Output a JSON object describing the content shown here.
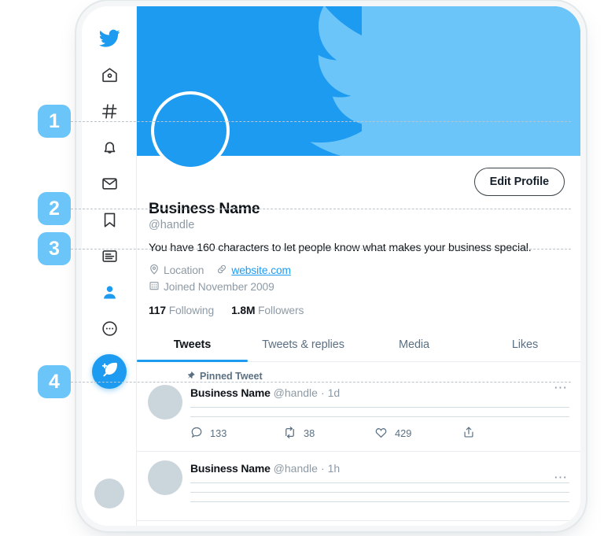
{
  "sidebar": {
    "items": [
      {
        "name": "twitter-logo",
        "icon": "twitter-bird-icon",
        "label": "Twitter"
      },
      {
        "name": "home",
        "icon": "home-icon",
        "label": "Home"
      },
      {
        "name": "explore",
        "icon": "hashtag-icon",
        "label": "Explore"
      },
      {
        "name": "notifications",
        "icon": "bell-icon",
        "label": "Notifications"
      },
      {
        "name": "messages",
        "icon": "envelope-icon",
        "label": "Messages"
      },
      {
        "name": "bookmarks",
        "icon": "bookmark-icon",
        "label": "Bookmarks"
      },
      {
        "name": "lists",
        "icon": "list-icon",
        "label": "Lists"
      },
      {
        "name": "profile",
        "icon": "person-icon",
        "label": "Profile"
      },
      {
        "name": "more",
        "icon": "more-circle-icon",
        "label": "More"
      }
    ],
    "compose": {
      "icon": "feather-plus-icon",
      "label": "Tweet"
    },
    "avatar": {
      "icon": "account-avatar",
      "label": "Account"
    }
  },
  "banner": {
    "background_color": "#1d9bf0",
    "accent_color": "#6cc5f9",
    "bird_icon": "twitter-bird-silhouette"
  },
  "profile": {
    "avatar_color": "#1d9bf0",
    "edit_button_label": "Edit Profile",
    "display_name": "Business Name",
    "handle": "@handle",
    "bio": "You have 160 characters to let people know what makes your business special.",
    "location_icon": "location-pin-icon",
    "location": "Location",
    "link_icon": "link-chain-icon",
    "website": "website.com",
    "website_color": "#1d9bf0",
    "calendar_icon": "calendar-icon",
    "joined": "Joined November 2009",
    "following_count": "117",
    "following_label": "Following",
    "followers_count": "1.8M",
    "followers_label": "Followers"
  },
  "tabs": [
    {
      "label": "Tweets",
      "active": true
    },
    {
      "label": "Tweets & replies",
      "active": false
    },
    {
      "label": "Media",
      "active": false
    },
    {
      "label": "Likes",
      "active": false
    }
  ],
  "tweets": [
    {
      "pinned_icon": "pin-icon",
      "pinned_label": "Pinned Tweet",
      "name": "Business Name",
      "handle": "@handle",
      "separator": "·",
      "time": "1d",
      "more_icon": "more-horizontal-icon",
      "body_lines": 2,
      "actions": {
        "reply_icon": "reply-bubble-icon",
        "reply_count": "133",
        "retweet_icon": "retweet-icon",
        "retweet_count": "38",
        "like_icon": "heart-icon",
        "like_count": "429",
        "share_icon": "share-upload-icon"
      }
    },
    {
      "name": "Business Name",
      "handle": "@handle",
      "separator": "·",
      "time": "1h",
      "more_icon": "more-horizontal-icon",
      "body_lines": 3
    }
  ],
  "callouts": [
    {
      "number": "1"
    },
    {
      "number": "2"
    },
    {
      "number": "3"
    },
    {
      "number": "4"
    }
  ],
  "colors": {
    "brand_blue": "#1d9bf0",
    "callout_blue": "#6cc5f9",
    "text_primary": "#0f1419",
    "text_muted": "#8d9aa5"
  }
}
